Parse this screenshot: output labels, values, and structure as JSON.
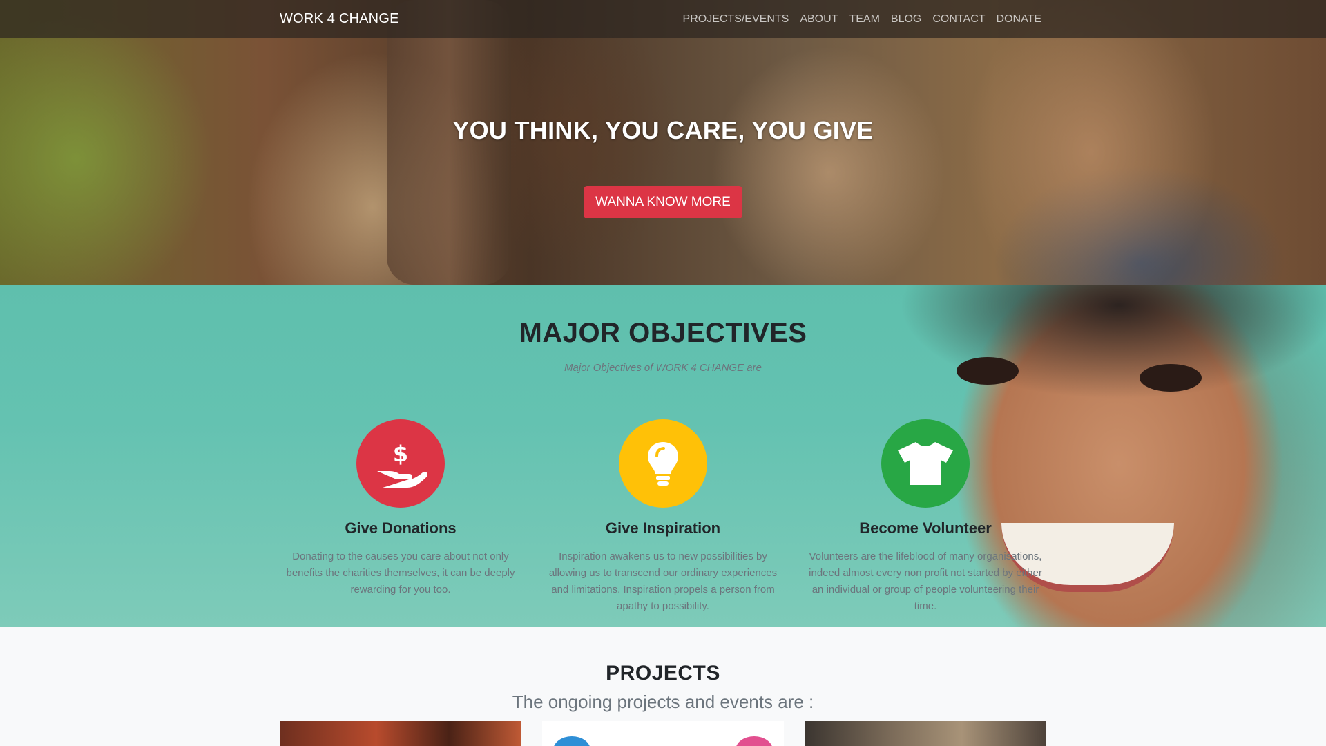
{
  "navbar": {
    "brand": "WORK 4 CHANGE",
    "links": [
      "PROJECTS/EVENTS",
      "ABOUT",
      "TEAM",
      "BLOG",
      "CONTACT",
      "DONATE"
    ]
  },
  "hero": {
    "title": "YOU THINK, YOU CARE, YOU GIVE",
    "button_label": "WANNA KNOW MORE"
  },
  "objectives": {
    "title": "MAJOR OBJECTIVES",
    "subtitle": "Major Objectives of WORK 4 CHANGE are",
    "items": [
      {
        "icon": "hand-holding-dollar-icon",
        "color": "#dc3545",
        "heading": "Give Donations",
        "text": "Donating to the causes you care about not only benefits the charities themselves, it can be deeply rewarding for you too."
      },
      {
        "icon": "lightbulb-icon",
        "color": "#ffc107",
        "heading": "Give Inspiration",
        "text": "Inspiration awakens us to new possibilities by allowing us to transcend our ordinary experiences and limitations. Inspiration propels a person from apathy to possibility."
      },
      {
        "icon": "tshirt-icon",
        "color": "#28a745",
        "heading": "Become Volunteer",
        "text": "Volunteers are the lifeblood of many organisations, indeed almost every non profit not started by either an individual or group of people volunteering their time."
      }
    ]
  },
  "projects": {
    "title": "PROJECTS",
    "subtitle": "The ongoing projects and events are :"
  },
  "colors": {
    "primary": "#dc3545",
    "warning": "#ffc107",
    "success": "#28a745",
    "muted": "#6c757d"
  }
}
